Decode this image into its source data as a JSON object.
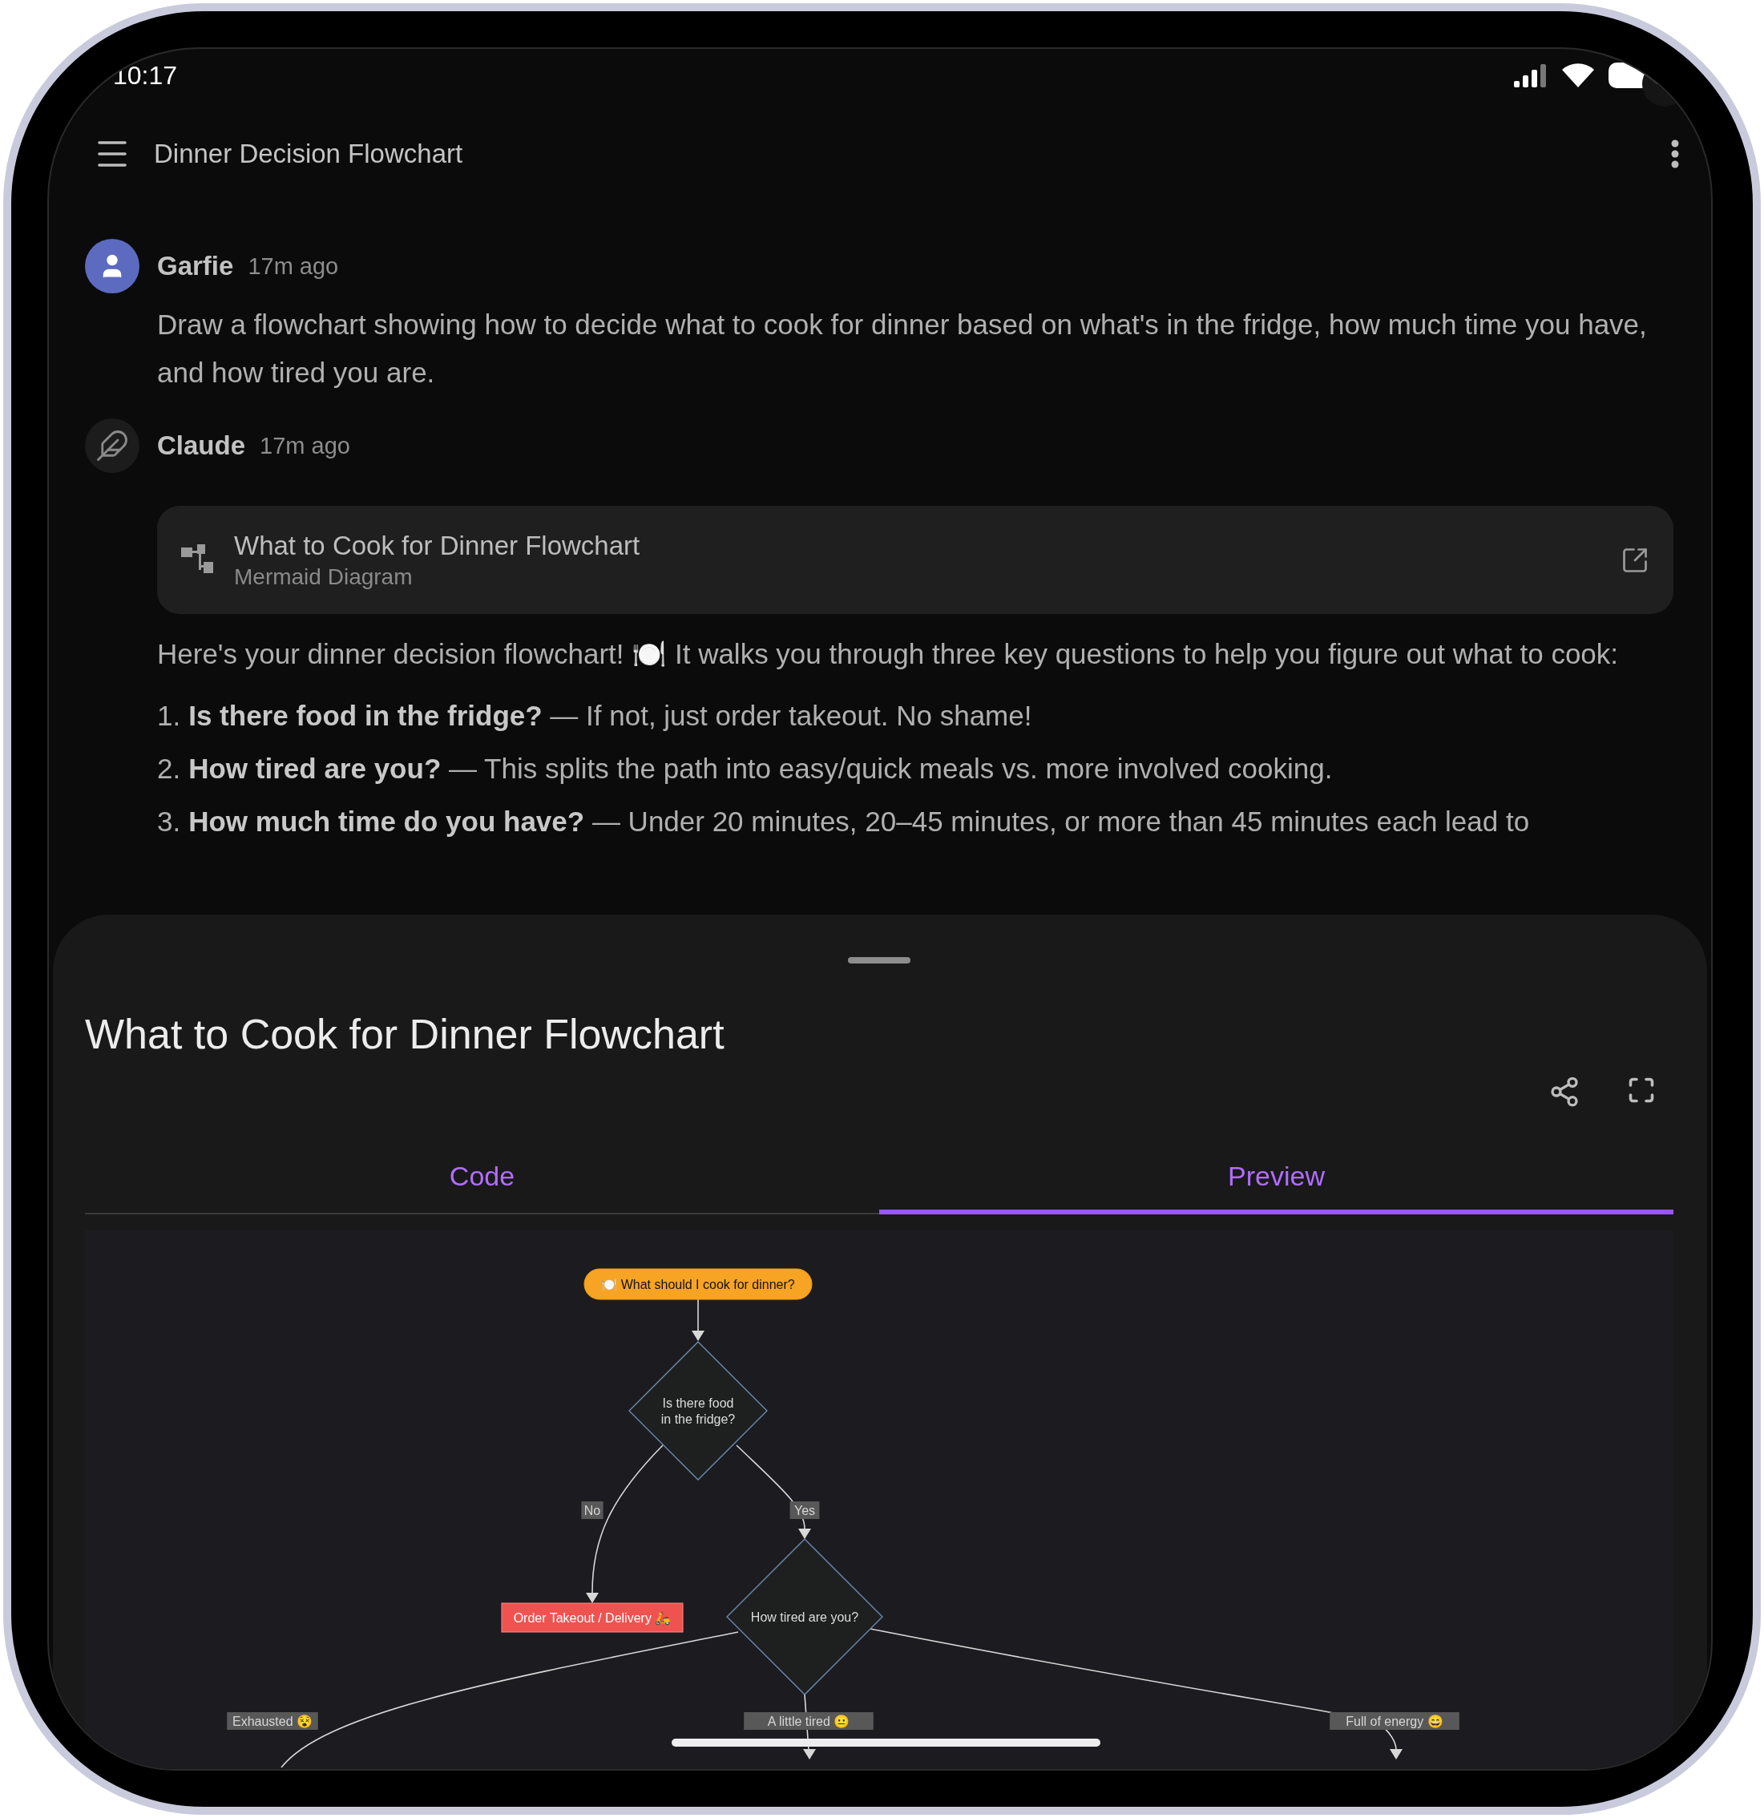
{
  "status_bar": {
    "time": "10:17"
  },
  "app_bar": {
    "title": "Dinner Decision Flowchart"
  },
  "messages": [
    {
      "kind": "user",
      "author": "Garfie",
      "time": "17m ago",
      "text": "Draw a flowchart showing how to decide what to cook for dinner based on what's in the fridge, how much time you have, and how tired you are."
    },
    {
      "kind": "assistant",
      "author": "Claude",
      "time": "17m ago",
      "artifact": {
        "title": "What to Cook for Dinner Flowchart",
        "subtitle": "Mermaid Diagram"
      },
      "text": "Here's your dinner decision flowchart! 🍽️ It walks you through three key questions to help you figure out what to cook:",
      "list": [
        {
          "number": "1.",
          "text": "**Is there food in the fridge?** — If not, just order takeout. No shame!"
        },
        {
          "number": "2.",
          "text": "**How tired are you?** — This splits the path into easy/quick meals vs. more involved cooking."
        },
        {
          "number": "3.",
          "text": "**How much time do you have?** — Under 20 minutes, 20–45 minutes, or more than 45 minutes each lead to"
        }
      ]
    }
  ],
  "sheet": {
    "title": "What to Cook for Dinner Flowchart",
    "tabs": [
      {
        "label": "Code",
        "selected": false
      },
      {
        "label": "Preview",
        "selected": true
      }
    ],
    "flowchart": {
      "nodes": [
        {
          "kind": "start",
          "text": "🍽️ What should I cook for dinner?"
        },
        {
          "kind": "decision",
          "lines": [
            "Is there food",
            "in the fridge?"
          ]
        },
        {
          "kind": "outcome",
          "text": "Order Takeout / Delivery 🛵"
        },
        {
          "kind": "decision",
          "lines": [
            "How tired are you?"
          ]
        }
      ],
      "edge_labels": [
        "No",
        "Yes",
        "Exhausted 😵",
        "A little tired 😐",
        "Full of energy 😄"
      ]
    }
  }
}
